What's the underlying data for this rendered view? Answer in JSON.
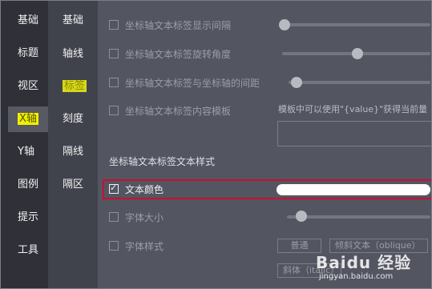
{
  "nav_main": {
    "items": [
      {
        "label": "基础"
      },
      {
        "label": "标题"
      },
      {
        "label": "视区"
      },
      {
        "label": "X轴"
      },
      {
        "label": "Y轴"
      },
      {
        "label": "图例"
      },
      {
        "label": "提示"
      },
      {
        "label": "工具"
      }
    ],
    "active": "X轴"
  },
  "nav_sub": {
    "items": [
      {
        "label": "基础"
      },
      {
        "label": "轴线"
      },
      {
        "label": "标签"
      },
      {
        "label": "刻度"
      },
      {
        "label": "隔线"
      },
      {
        "label": "隔区"
      }
    ],
    "active": "标签"
  },
  "settings": {
    "show_interval": {
      "label": "坐标轴文本标签显示间隔",
      "checked": false,
      "value_fraction": 0.0
    },
    "rotate": {
      "label": "坐标轴文本标签旋转角度",
      "checked": false,
      "value_fraction": 0.5
    },
    "margin": {
      "label": "坐标轴文本标签与坐标轴的间距",
      "checked": false,
      "value_fraction": 0.08
    },
    "template": {
      "label": "坐标轴文本标签内容模板",
      "checked": false,
      "hint": "模板中可以使用\"{value}\"获得当前量",
      "value": ""
    },
    "section_title": "坐标轴文本标签文本样式",
    "text_color": {
      "label": "文本颜色",
      "checked": true,
      "color": "#ffffff"
    },
    "font_size": {
      "label": "字体大小",
      "checked": false,
      "value_fraction": 0.1
    },
    "font_style": {
      "label": "字体样式",
      "checked": false,
      "options": [
        "普通",
        "倾斜文本（oblique）",
        "斜体（italic）"
      ]
    }
  },
  "watermark": {
    "text": "Baidu 经验",
    "url": "jingyan.baidu.com"
  },
  "colors": {
    "highlight": "#c8102e",
    "active_marker": "#f0f000"
  }
}
